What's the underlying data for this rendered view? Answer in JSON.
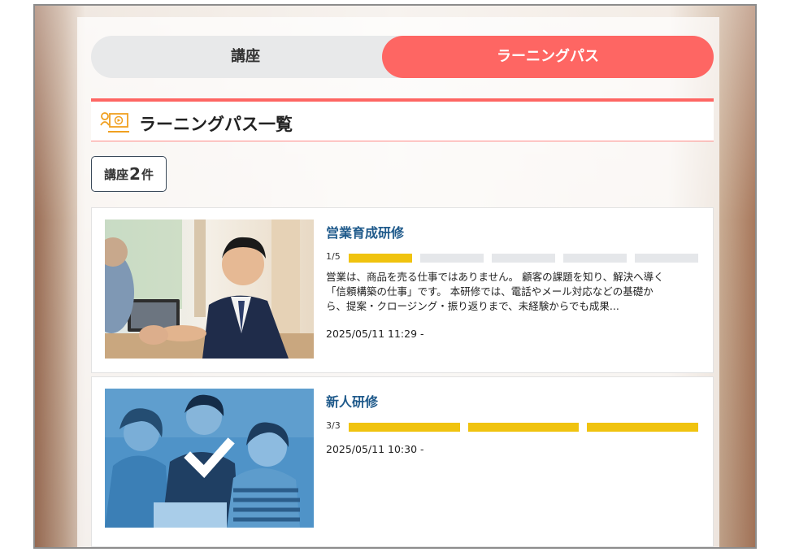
{
  "tabs": {
    "courses_label": "講座",
    "learning_path_label": "ラーニングパス"
  },
  "section": {
    "title": "ラーニングパス一覧"
  },
  "count": {
    "prefix": "講座",
    "number": "2",
    "suffix": "件"
  },
  "colors": {
    "accent": "#fe6663",
    "progress_fill": "#f0c30f",
    "progress_empty": "#e5e7ea",
    "title_link": "#1f5a8b"
  },
  "paths": [
    {
      "title": "営業育成研修",
      "progress_label": "1/5",
      "completed": 1,
      "total": 5,
      "description_lines": [
        "営業は、商品を売る仕事ではありません。 顧客の課題を知り、解決へ導く",
        "「信頼構築の仕事」です。 本研修では、電話やメール対応などの基礎か",
        "ら、提案・クロージング・振り返りまで、未経験からでも成果..."
      ],
      "date": "2025/05/11 11:29 -"
    },
    {
      "title": "新人研修",
      "progress_label": "3/3",
      "completed": 3,
      "total": 3,
      "description_lines": [],
      "date": "2025/05/11 10:30 -",
      "completed_icon": "check-icon"
    }
  ]
}
